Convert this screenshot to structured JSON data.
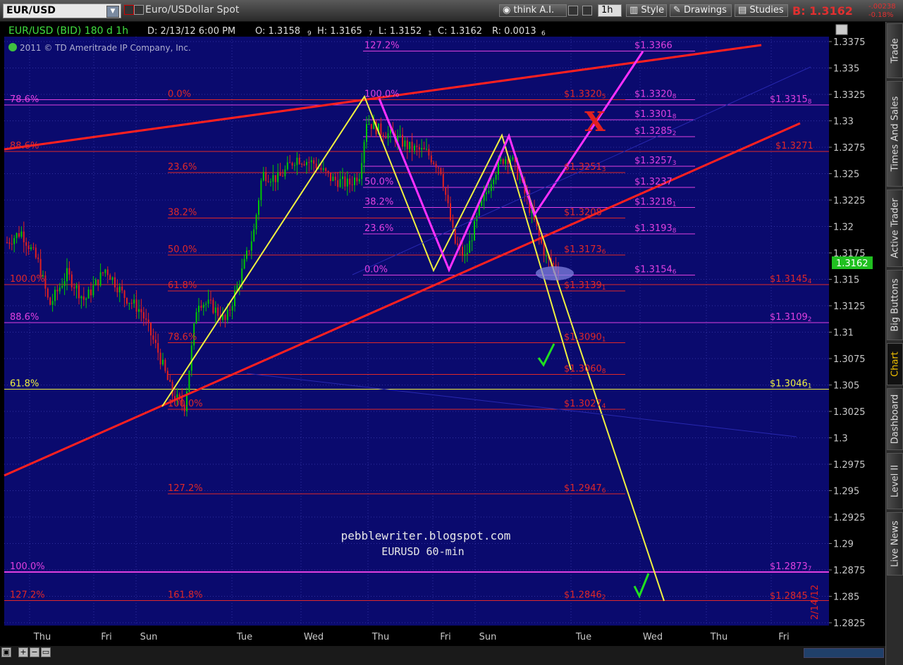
{
  "toolbar": {
    "symbol": "EUR/USD",
    "description": "Euro/USDollar Spot",
    "think_ai": "think A.I.",
    "timeframe": "1h",
    "style": "Style",
    "drawings": "Drawings",
    "studies": "Studies",
    "bid": "B: 1.3162",
    "change1": "-.00238",
    "change2": "-0.18%"
  },
  "sidebar": {
    "tabs": [
      "Trade",
      "Times And Sales",
      "Active Trader",
      "Big Buttons",
      "Chart",
      "Dashboard",
      "Level II",
      "Live News"
    ],
    "active": "Chart"
  },
  "header": {
    "info": "EUR/USD (BID) 180 d 1h",
    "date": "D: 2/13/12 6:00 PM",
    "open": "O: 1.3158",
    "open_sub": "9",
    "high": "H: 1.3165",
    "high_sub": "7",
    "low": "L: 1.3152",
    "low_sub": "1",
    "close": "C: 1.3162",
    "range": "R: 0.0013",
    "range_sub": "6",
    "copyright": "2011 © TD Ameritrade IP Company, Inc."
  },
  "colors": {
    "background": "#0a0a6e",
    "bull_candle": "#00c800",
    "bear_candle": "#e02020",
    "fib_red": "#e02828",
    "fib_magenta": "#e040e0",
    "trend_red": "#ff2020",
    "pattern_yellow": "#f0f040",
    "pattern_magenta": "#ff30ff",
    "check_green": "#20e020",
    "last_price_box": "#20c020"
  },
  "icons": [
    "dropdown-arrow-icon",
    "link-icon",
    "grid-icon",
    "think-ai-icon",
    "tools-icon",
    "bars-icon",
    "style-icon",
    "drawings-icon",
    "studies-icon",
    "camera-icon",
    "zoom-in-icon",
    "zoom-out-icon",
    "scroll-icon"
  ],
  "chart_data": {
    "type": "candlestick",
    "title": "pebblewriter.blogspot.com",
    "subtitle": "EURUSD 60-min",
    "ylim": [
      1.281,
      1.3385
    ],
    "y_ticks": [
      "1.3375",
      "1.335",
      "1.3325",
      "1.33",
      "1.3275",
      "1.325",
      "1.3225",
      "1.32",
      "1.3175",
      "1.315",
      "1.3125",
      "1.31",
      "1.3075",
      "1.305",
      "1.3025",
      "1.3",
      "1.2975",
      "1.295",
      "1.2925",
      "1.29",
      "1.2875",
      "1.285",
      "1.2825"
    ],
    "x_ticks": [
      "Thu",
      "Fri",
      "Sun",
      "Tue",
      "Wed",
      "Thu",
      "Fri",
      "Sun",
      "Tue",
      "Wed",
      "Thu",
      "Fri"
    ],
    "date_label": "2/14/12",
    "last_price": "1.3162",
    "check_marks": 2,
    "x_mark_label": "X",
    "level_labels": [
      {
        "price": 1.3366,
        "label": "$1.3366",
        "color": "magenta"
      },
      {
        "price": 1.332,
        "label": "$1.3320",
        "sub": "5",
        "color": "red"
      },
      {
        "price": 1.332,
        "label": "$1.3320",
        "sub": "8",
        "color": "magenta"
      },
      {
        "price": 1.3315,
        "label": "$1.3315",
        "sub": "8",
        "color": "magenta"
      },
      {
        "price": 1.3301,
        "label": "$1.3301",
        "sub": "8",
        "color": "magenta"
      },
      {
        "price": 1.3285,
        "label": "$1.3285",
        "sub": "2",
        "color": "magenta"
      },
      {
        "price": 1.3271,
        "label": "$1.3271",
        "color": "red"
      },
      {
        "price": 1.3257,
        "label": "$1.3257",
        "sub": "3",
        "color": "magenta"
      },
      {
        "price": 1.3251,
        "label": "$1.3251",
        "sub": "3",
        "color": "red"
      },
      {
        "price": 1.3237,
        "label": "$1.3237",
        "color": "magenta"
      },
      {
        "price": 1.3218,
        "label": "$1.3218",
        "sub": "1",
        "color": "magenta"
      },
      {
        "price": 1.3208,
        "label": "$1.3208",
        "color": "red"
      },
      {
        "price": 1.3193,
        "label": "$1.3193",
        "sub": "8",
        "color": "magenta"
      },
      {
        "price": 1.3173,
        "label": "$1.3173",
        "sub": "6",
        "color": "red"
      },
      {
        "price": 1.3154,
        "label": "$1.3154",
        "sub": "6",
        "color": "magenta"
      },
      {
        "price": 1.3145,
        "label": "$1.3145",
        "sub": "4",
        "color": "red"
      },
      {
        "price": 1.3139,
        "label": "$1.3139",
        "sub": "1",
        "color": "red"
      },
      {
        "price": 1.3109,
        "label": "$1.3109",
        "sub": "2",
        "color": "magenta"
      },
      {
        "price": 1.309,
        "label": "$1.3090",
        "sub": "1",
        "color": "red"
      },
      {
        "price": 1.306,
        "label": "$1.3060",
        "sub": "8",
        "color": "red"
      },
      {
        "price": 1.3046,
        "label": "$1.3046",
        "sub": "1",
        "color": "yellow"
      },
      {
        "price": 1.3027,
        "label": "$1.3027",
        "sub": "4",
        "color": "red"
      },
      {
        "price": 1.2947,
        "label": "$1.2947",
        "sub": "6",
        "color": "red"
      },
      {
        "price": 1.2873,
        "label": "$1.2873",
        "sub": "7",
        "color": "magenta"
      },
      {
        "price": 1.2846,
        "label": "$1.2846",
        "sub": "2",
        "color": "red"
      },
      {
        "price": 1.2845,
        "label": "$1.2845",
        "color": "red"
      }
    ],
    "fib_labels": [
      {
        "text": "127.2%",
        "price": 1.3366,
        "color": "magenta"
      },
      {
        "text": "78.6%",
        "price": 1.3315,
        "color": "magenta"
      },
      {
        "text": "0.0%",
        "price": 1.332,
        "color": "red"
      },
      {
        "text": "100.0%",
        "price": 1.332,
        "color": "magenta"
      },
      {
        "text": "88.6%",
        "price": 1.3271,
        "color": "red"
      },
      {
        "text": "23.6%",
        "price": 1.3251,
        "color": "red"
      },
      {
        "text": "50.0%",
        "price": 1.3237,
        "color": "magenta"
      },
      {
        "text": "38.2%",
        "price": 1.3208,
        "color": "red"
      },
      {
        "text": "38.2%",
        "price": 1.3218,
        "color": "magenta"
      },
      {
        "text": "23.6%",
        "price": 1.3193,
        "color": "magenta"
      },
      {
        "text": "50.0%",
        "price": 1.3173,
        "color": "red"
      },
      {
        "text": "0.0%",
        "price": 1.3154,
        "color": "magenta"
      },
      {
        "text": "100.0%",
        "price": 1.3145,
        "color": "red"
      },
      {
        "text": "61.8%",
        "price": 1.3139,
        "color": "red"
      },
      {
        "text": "88.6%",
        "price": 1.3109,
        "color": "magenta"
      },
      {
        "text": "78.6%",
        "price": 1.309,
        "color": "red"
      },
      {
        "text": "61.8%",
        "price": 1.3046,
        "color": "yellow"
      },
      {
        "text": "100.0%",
        "price": 1.3027,
        "color": "red"
      },
      {
        "text": "127.2%",
        "price": 1.2947,
        "color": "red"
      },
      {
        "text": "100.0%",
        "price": 1.2873,
        "color": "magenta"
      },
      {
        "text": "127.2%",
        "price": 1.2846,
        "color": "red"
      },
      {
        "text": "161.8%",
        "price": 1.2846,
        "color": "red"
      }
    ]
  }
}
